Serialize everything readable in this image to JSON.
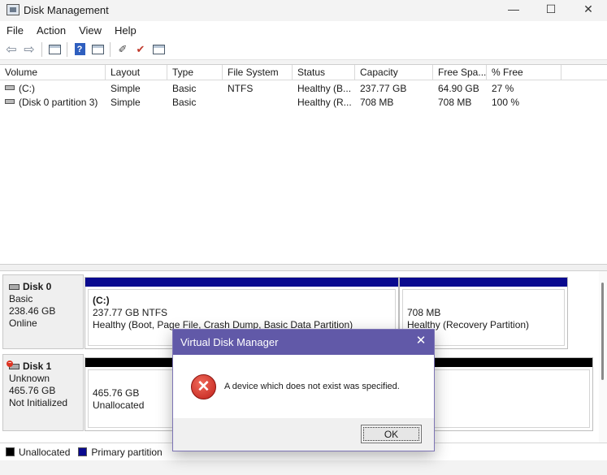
{
  "window": {
    "title": "Disk Management",
    "controls": [
      "—",
      "☐",
      "✕"
    ]
  },
  "menu": [
    "File",
    "Action",
    "View",
    "Help"
  ],
  "volume_list": {
    "columns": [
      "Volume",
      "Layout",
      "Type",
      "File System",
      "Status",
      "Capacity",
      "Free Spa...",
      "% Free"
    ],
    "rows": [
      [
        "(C:)",
        "Simple",
        "Basic",
        "NTFS",
        "Healthy (B...",
        "237.77 GB",
        "64.90 GB",
        "27 %"
      ],
      [
        "(Disk 0 partition 3)",
        "Simple",
        "Basic",
        "",
        "Healthy (R...",
        "708 MB",
        "708 MB",
        "100 %"
      ]
    ]
  },
  "disks": [
    {
      "name": "Disk 0",
      "type": "Basic",
      "size": "238.46 GB",
      "state": "Online",
      "partitions": [
        {
          "name": "(C:)",
          "line1": "237.77 GB NTFS",
          "line2": "Healthy (Boot, Page File, Crash Dump, Basic Data Partition)",
          "color": "#0a0a8f"
        },
        {
          "name": "",
          "line1": "708 MB",
          "line2": "Healthy (Recovery Partition)",
          "color": "#0a0a8f"
        }
      ]
    },
    {
      "name": "Disk 1",
      "type": "Unknown",
      "size": "465.76 GB",
      "state": "Not Initialized",
      "partitions": [
        {
          "name": "",
          "line1": "465.76 GB",
          "line2": "Unallocated",
          "color": "#000000"
        }
      ]
    }
  ],
  "legend": [
    {
      "label": "Unallocated",
      "color": "#000000"
    },
    {
      "label": "Primary partition",
      "color": "#0a0a8f"
    }
  ],
  "dialog": {
    "title": "Virtual Disk Manager",
    "message": "A device which does not exist was specified.",
    "ok_label": "OK"
  }
}
